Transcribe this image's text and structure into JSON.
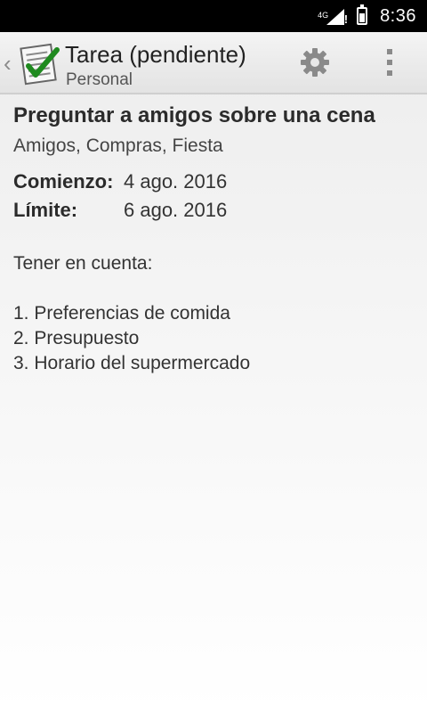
{
  "status_bar": {
    "network": "4G",
    "time": "8:36"
  },
  "action_bar": {
    "title": "Tarea (pendiente)",
    "subtitle": "Personal",
    "icons": [
      "up-chevron-icon",
      "task-checklist-icon",
      "settings-gear-icon",
      "overflow-menu-icon"
    ]
  },
  "task": {
    "title": "Preguntar a amigos sobre una cena",
    "tags": "Amigos, Compras, Fiesta",
    "start_label": "Comienzo:",
    "start_value": "4 ago. 2016",
    "due_label": "Límite:",
    "due_value": "6 ago. 2016",
    "notes_intro": "Tener en cuenta:",
    "notes_items": [
      "1. Preferencias de comida",
      "2. Presupuesto",
      "3. Horario del supermercado"
    ]
  },
  "colors": {
    "status_bar": "#000000",
    "check_green": "#1f8a1f",
    "icon_gray": "#8a8a8a"
  }
}
